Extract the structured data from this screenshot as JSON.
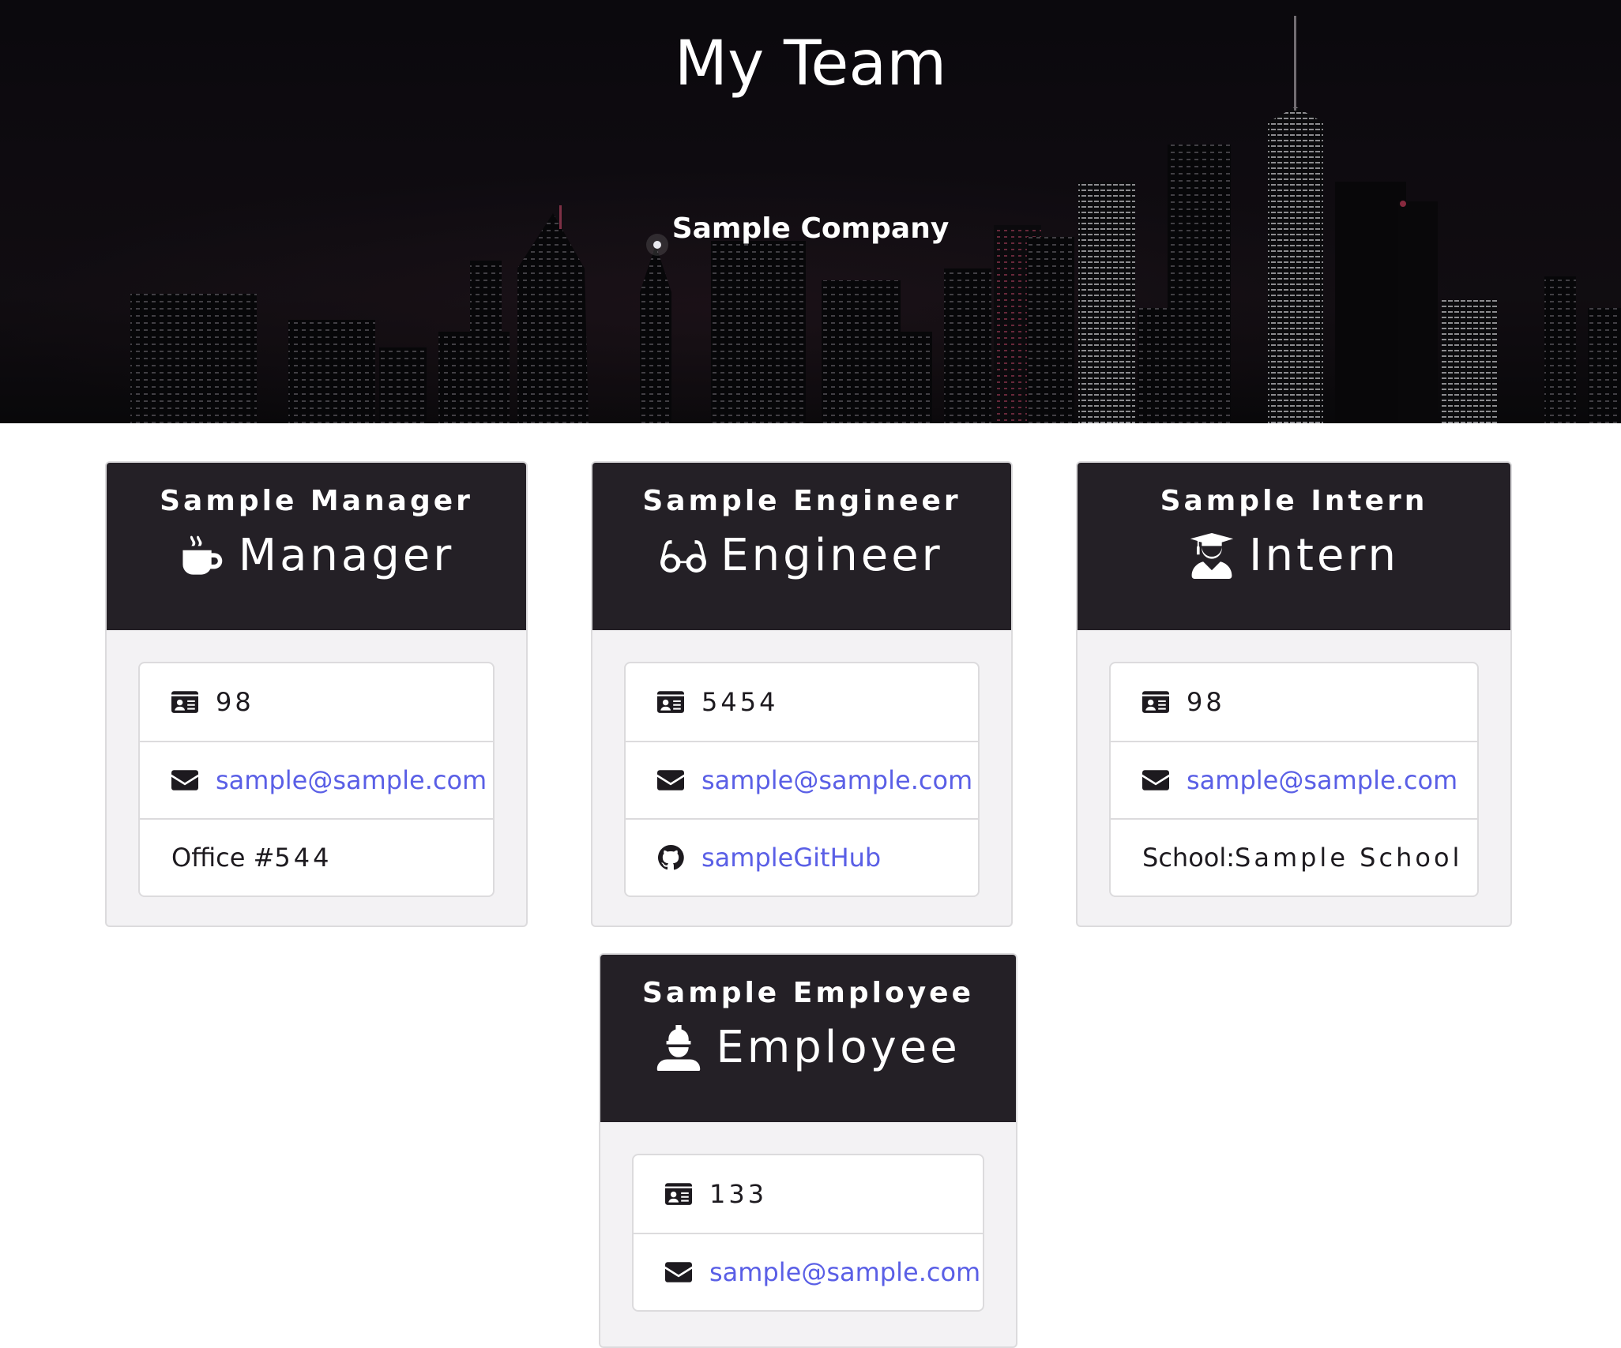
{
  "header": {
    "title": "My Team",
    "subtitle": "Sample Company"
  },
  "colors": {
    "card_header_bg": "#242026",
    "card_body_bg": "#f3f2f4",
    "link": "#5a5fe6",
    "text": "#1d1a1f"
  },
  "team": [
    {
      "name": "Sample Manager",
      "role": "Manager",
      "role_icon": "mug-hot-icon",
      "id": "98",
      "email": "sample@sample.com",
      "extra_label": "Office #",
      "extra_value": "544"
    },
    {
      "name": "Sample Engineer",
      "role": "Engineer",
      "role_icon": "glasses-icon",
      "id": "5454",
      "email": "sample@sample.com",
      "github": "sampleGitHub"
    },
    {
      "name": "Sample Intern",
      "role": "Intern",
      "role_icon": "user-graduate-icon",
      "id": "98",
      "email": "sample@sample.com",
      "extra_label": "School: ",
      "extra_value": "Sample School"
    },
    {
      "name": "Sample Employee",
      "role": "Employee",
      "role_icon": "hard-hat-worker-icon",
      "id": "133",
      "email": "sample@sample.com"
    }
  ]
}
